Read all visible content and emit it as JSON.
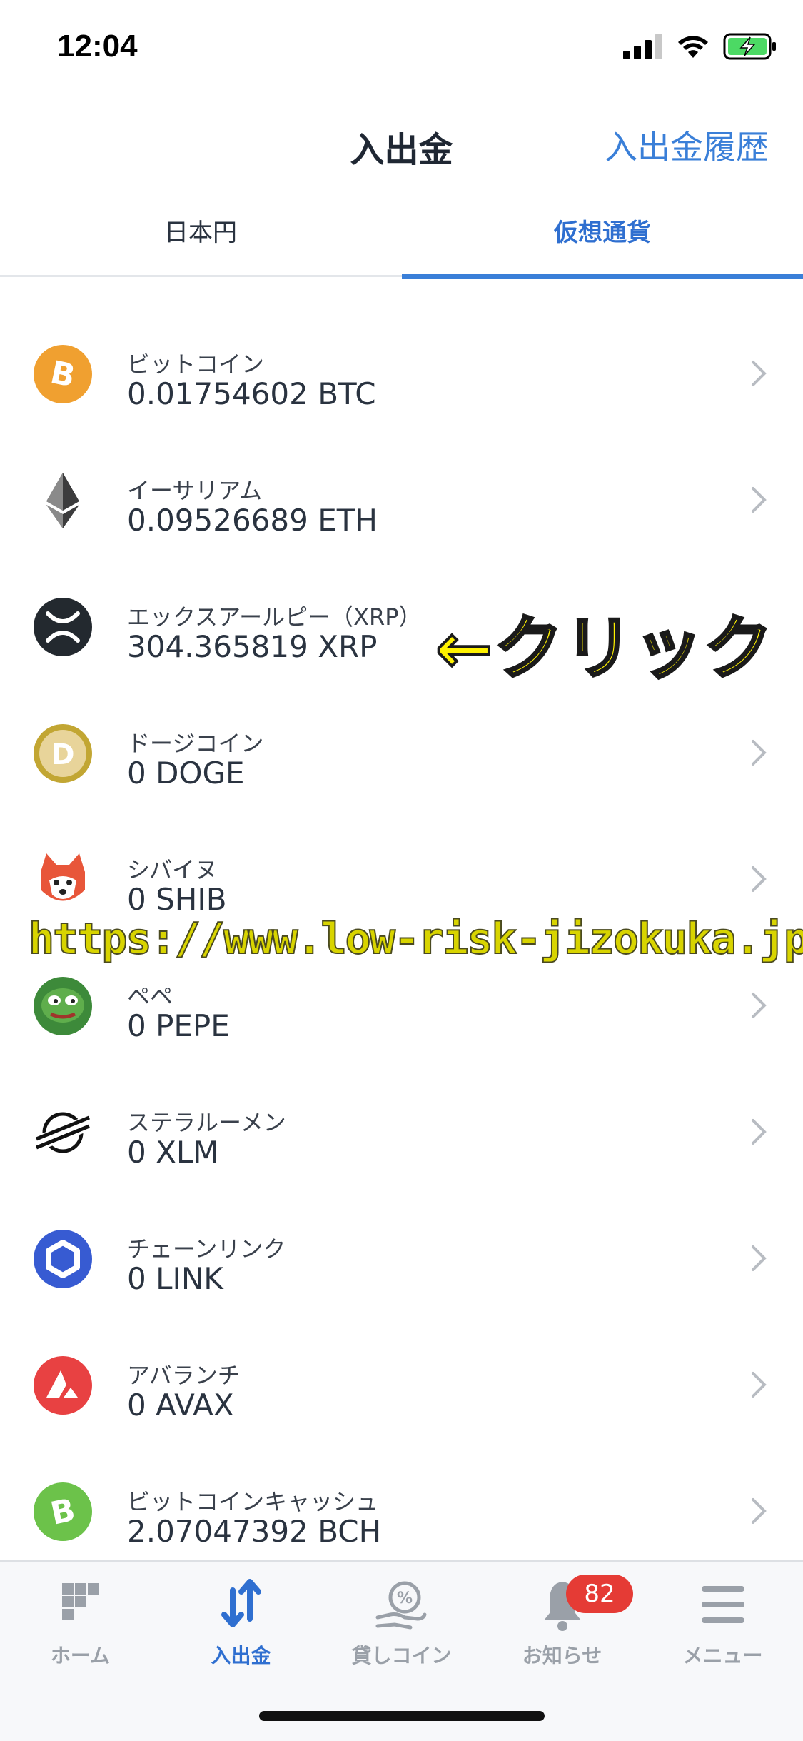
{
  "status_bar": {
    "time": "12:04"
  },
  "header": {
    "title": "入出金",
    "history_link": "入出金履歴"
  },
  "tabs": [
    {
      "label": "日本円",
      "active": false
    },
    {
      "label": "仮想通貨",
      "active": true
    }
  ],
  "coins": [
    {
      "name": "ビットコイン",
      "amount": "0.01754602 BTC",
      "icon": "bitcoin-icon",
      "color": "#f0a030"
    },
    {
      "name": "イーサリアム",
      "amount": "0.09526689 ETH",
      "icon": "ethereum-icon",
      "color": "#3c3c3d"
    },
    {
      "name": "エックスアールピー（XRP）",
      "amount": "304.365819 XRP",
      "icon": "xrp-icon",
      "color": "#23292f"
    },
    {
      "name": "ドージコイン",
      "amount": "0 DOGE",
      "icon": "dogecoin-icon",
      "color": "#c2a633"
    },
    {
      "name": "シバイヌ",
      "amount": "0 SHIB",
      "icon": "shiba-inu-icon",
      "color": "#e8563a"
    },
    {
      "name": "ペペ",
      "amount": "0 PEPE",
      "icon": "pepe-icon",
      "color": "#3d8a3a"
    },
    {
      "name": "ステラルーメン",
      "amount": "0 XLM",
      "icon": "stellar-icon",
      "color": "#111111"
    },
    {
      "name": "チェーンリンク",
      "amount": "0 LINK",
      "icon": "chainlink-icon",
      "color": "#375bd2"
    },
    {
      "name": "アバランチ",
      "amount": "0 AVAX",
      "icon": "avalanche-icon",
      "color": "#e84142"
    },
    {
      "name": "ビットコインキャッシュ",
      "amount": "2.07047392 BCH",
      "icon": "bitcoin-cash-icon",
      "color": "#6cc24a"
    }
  ],
  "annotation": {
    "click_text": "←クリック"
  },
  "watermark": "https://www.low-risk-jizokuka.jp/",
  "bottom_nav": [
    {
      "label": "ホーム",
      "icon": "home-grid-icon",
      "active": false
    },
    {
      "label": "入出金",
      "icon": "transfer-arrows-icon",
      "active": true
    },
    {
      "label": "貸しコイン",
      "icon": "lending-coin-icon",
      "active": false
    },
    {
      "label": "お知らせ",
      "icon": "bell-icon",
      "active": false,
      "badge": "82"
    },
    {
      "label": "メニュー",
      "icon": "menu-icon",
      "active": false
    }
  ],
  "colors": {
    "accent": "#3a7fd8",
    "badge": "#e53b35",
    "annotation": "#fff200"
  }
}
